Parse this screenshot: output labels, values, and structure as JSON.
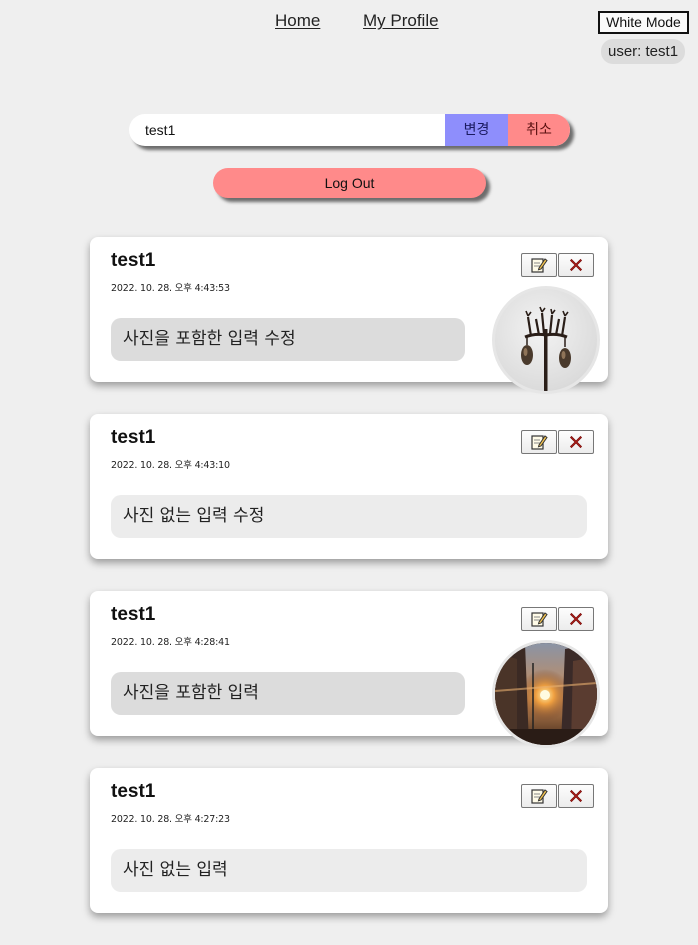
{
  "nav": {
    "home_label": "Home",
    "profile_label": "My Profile"
  },
  "mode_toggle_label": "White Mode",
  "user_badge": "user: test1",
  "edit_form": {
    "name_value": "test1",
    "change_label": "변경",
    "cancel_label": "취소"
  },
  "logout_label": "Log Out",
  "posts": [
    {
      "author": "test1",
      "date": "2022. 10. 28. 오후 4:43:53",
      "text": "사진을 포함한 입력 수정",
      "has_photo": true,
      "photo": "street-lamp-photo"
    },
    {
      "author": "test1",
      "date": "2022. 10. 28. 오후 4:43:10",
      "text": "사진 없는 입력 수정",
      "has_photo": false
    },
    {
      "author": "test1",
      "date": "2022. 10. 28. 오후 4:28:41",
      "text": "사진을 포함한 입력",
      "has_photo": true,
      "photo": "city-sunset-photo"
    },
    {
      "author": "test1",
      "date": "2022. 10. 28. 오후 4:27:23",
      "text": "사진 없는 입력",
      "has_photo": false
    }
  ],
  "icons": {
    "edit": "edit-icon",
    "delete": "delete-x-icon"
  },
  "colors": {
    "change_button": "#8e8efc",
    "cancel_button": "#ff8a8a",
    "logout_button": "#ff8a8a",
    "background": "#efefef"
  }
}
